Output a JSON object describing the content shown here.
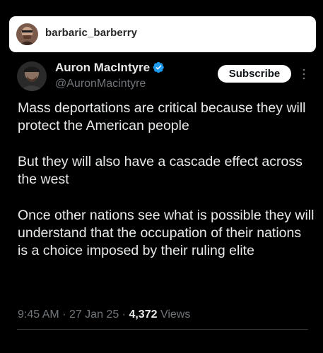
{
  "repost": {
    "username": "barbaric_barberry"
  },
  "tweet": {
    "author": {
      "display_name": "Auron MacIntyre",
      "handle": "@AuronMacintyre",
      "verified": true
    },
    "subscribe_label": "Subscribe",
    "paragraphs": [
      "Mass deportations are critical because they will protect the American people",
      "But they will also have a cascade effect across the west",
      "Once other nations see what is possible they will understand that the occupation of their nations is a choice imposed by their ruling elite"
    ],
    "time": "9:45 AM",
    "date": "27 Jan 25",
    "views_count": "4,372",
    "views_label": "Views"
  },
  "icons": {
    "verified": "verified-badge-icon",
    "more": "more-vertical-icon"
  },
  "colors": {
    "background": "#000000",
    "text": "#e7e9ea",
    "muted": "#71767b",
    "verified_blue": "#1d9bf0",
    "divider": "#2f3336",
    "repost_bar": "#ffffff"
  }
}
